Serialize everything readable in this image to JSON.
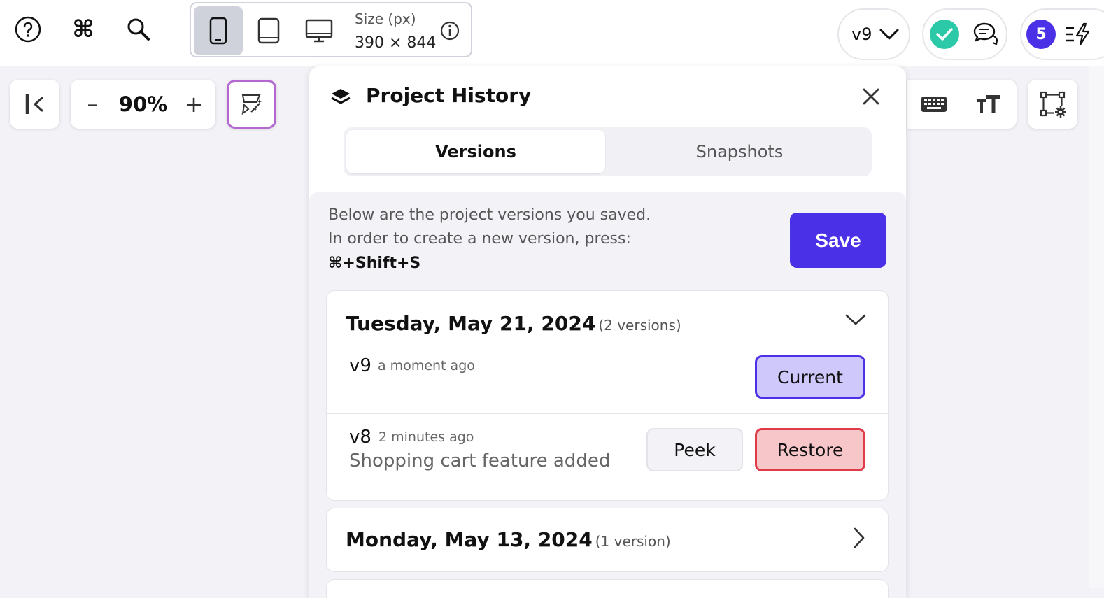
{
  "device_picker": {
    "size_label": "Size (px)",
    "size_value": "390 × 844"
  },
  "version_selector": {
    "label": "v9"
  },
  "user_badge": {
    "count": "5"
  },
  "zoom": {
    "value": "90%",
    "decrease": "–",
    "increase": "+"
  },
  "history_panel": {
    "title": "Project History",
    "tabs": [
      {
        "label": "Versions",
        "active": true
      },
      {
        "label": "Snapshots",
        "active": false
      }
    ],
    "intro_line1": "Below are the project versions you saved.",
    "intro_line2": "In order to create a new version, press:",
    "shortcut": "⌘+Shift+S",
    "save_label": "Save",
    "days": [
      {
        "date": "Tuesday, May 21, 2024",
        "count": "(2 versions)",
        "expanded": true,
        "versions": [
          {
            "name": "v9",
            "time": "a moment ago",
            "description": "",
            "action": "Current"
          },
          {
            "name": "v8",
            "time": "2 minutes ago",
            "description": "Shopping cart feature added",
            "peek": "Peek",
            "action": "Restore"
          }
        ]
      },
      {
        "date": "Monday, May 13, 2024",
        "count": "(1 version)",
        "expanded": false
      }
    ]
  },
  "colors": {
    "accent": "#4a30e6",
    "status_ok": "#2cc9a8",
    "restore": "#e03b48",
    "current_bg": "#cfc8fb"
  }
}
